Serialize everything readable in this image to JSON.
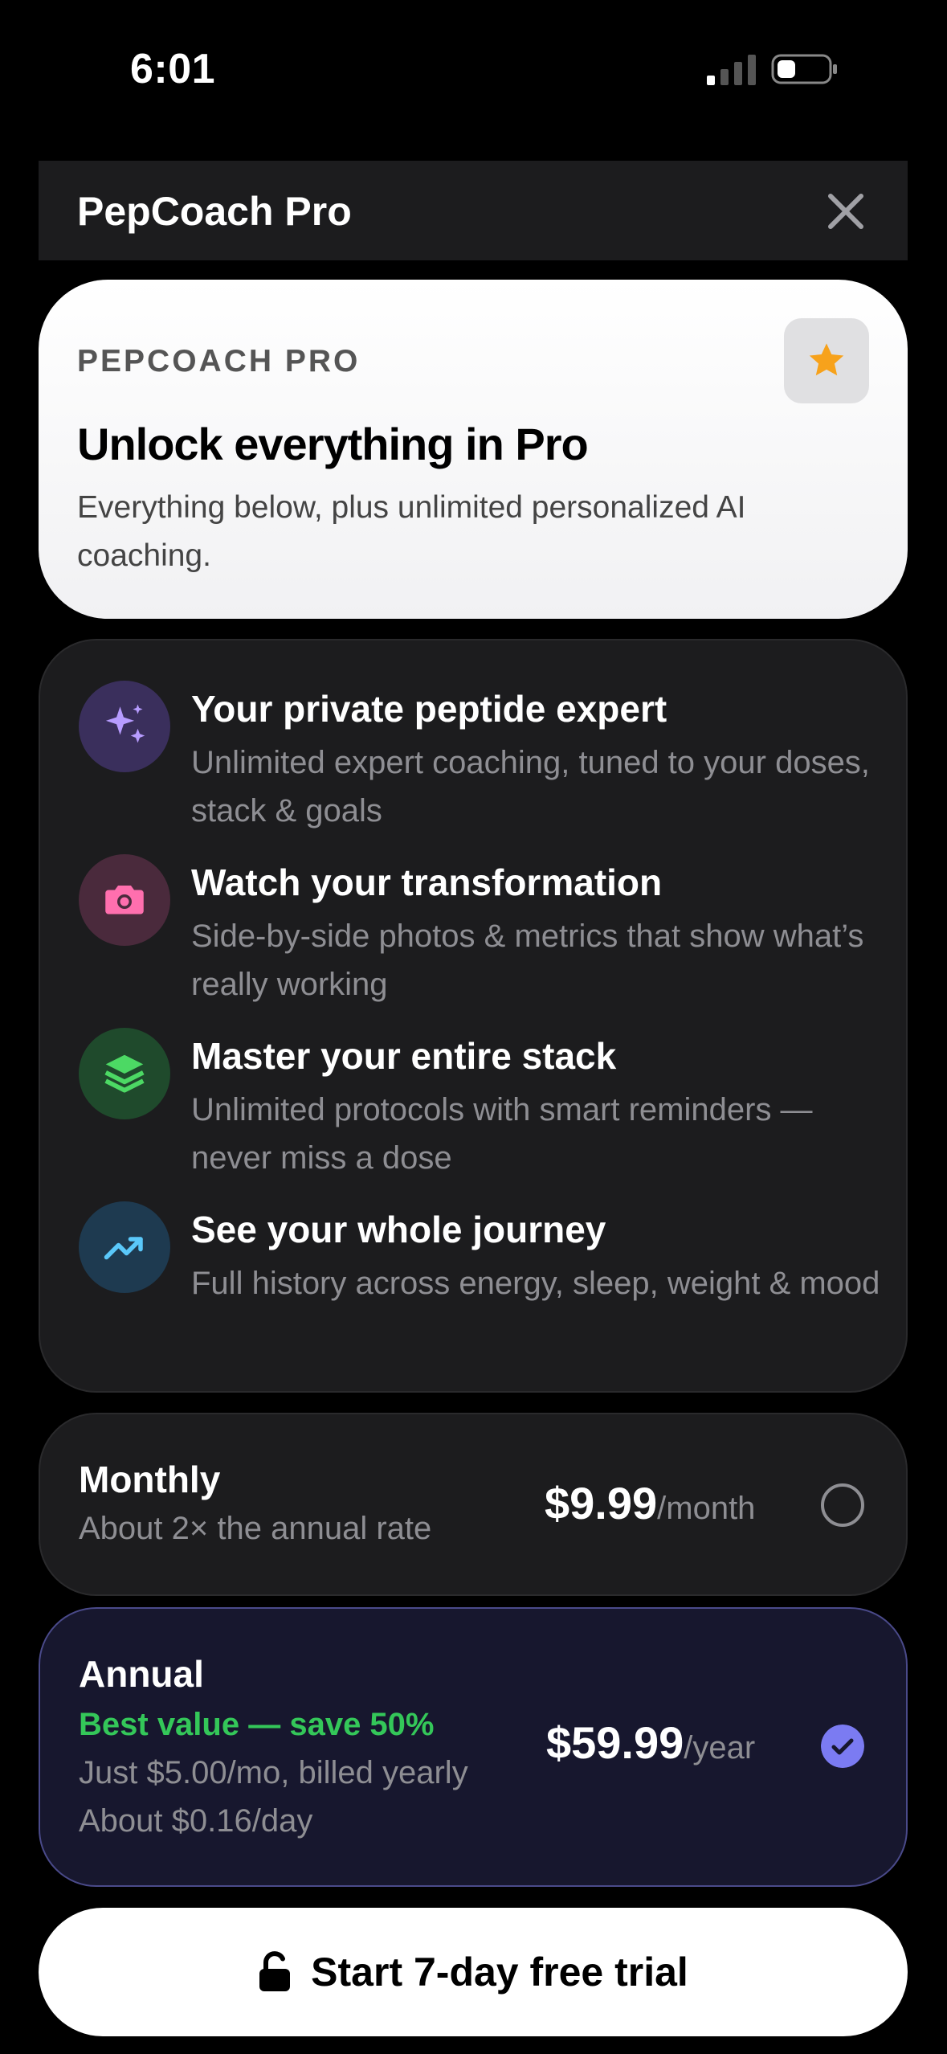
{
  "status_bar": {
    "time": "6:01"
  },
  "header": {
    "title": "PepCoach Pro",
    "close_icon": "close-icon"
  },
  "hero": {
    "eyebrow": "PEPCOACH PRO",
    "title": "Unlock everything in Pro",
    "subtitle": "Everything below, plus unlimited personalized AI coaching.",
    "badge_icon": "star-icon"
  },
  "features": [
    {
      "icon": "sparkles-icon",
      "title": "Your private peptide expert",
      "desc": "Unlimited expert coaching, tuned to your doses, stack & goals"
    },
    {
      "icon": "camera-icon",
      "title": "Watch your transformation",
      "desc": "Side-by-side photos & metrics that show what’s really working"
    },
    {
      "icon": "layers-icon",
      "title": "Master your entire stack",
      "desc": "Unlimited protocols with smart reminders — never miss a dose"
    },
    {
      "icon": "trend-up-icon",
      "title": "See your whole journey",
      "desc": "Full history across energy, sleep, weight & mood"
    }
  ],
  "plans": {
    "monthly": {
      "name": "Monthly",
      "note": "About 2× the annual rate",
      "price": "$9.99",
      "period": "/month",
      "selected": false
    },
    "annual": {
      "name": "Annual",
      "highlight": "Best value — save 50%",
      "note1": "Just $5.00/mo, billed yearly",
      "note2": "About $0.16/day",
      "price": "$59.99",
      "period": "/year",
      "selected": true
    }
  },
  "cta": {
    "label": "Start 7-day free trial",
    "icon": "lock-icon"
  },
  "colors": {
    "accent": "#7b7bf2",
    "green": "#34c759",
    "star": "#f7a21b"
  }
}
